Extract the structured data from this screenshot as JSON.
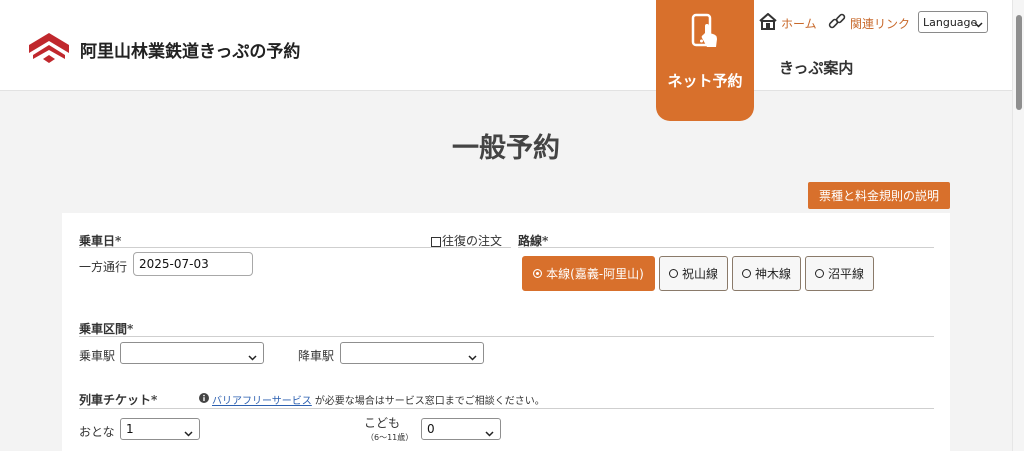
{
  "header": {
    "site_title": "阿里山林業鉄道きっぷの予約",
    "nav": {
      "net_reservation": "ネット予約",
      "ticket_guide": "きっぷ案内"
    },
    "links": {
      "home": "ホーム",
      "related": "関連リンク"
    },
    "language_select": "Language"
  },
  "page": {
    "title": "一般予約",
    "rules_button": "票種と料金規則の説明"
  },
  "form": {
    "ride_date": {
      "heading": "乗車日*",
      "one_way_label": "一方通行",
      "date_value": "2025-07-03",
      "round_trip_label": "往復の注文"
    },
    "route": {
      "heading": "路線*",
      "options": [
        "本線(嘉義-阿里山)",
        "祝山線",
        "神木線",
        "沼平線"
      ],
      "selected": "本線(嘉義-阿里山)"
    },
    "section": {
      "heading": "乗車区間*",
      "boarding_label": "乗車駅",
      "boarding_value": "",
      "alighting_label": "降車駅",
      "alighting_value": ""
    },
    "tickets": {
      "heading": "列車チケット*",
      "info_link": "バリアフリーサービス",
      "info_text": "が必要な場合はサービス窓口までご相談ください。",
      "adult_label": "おとな",
      "adult_value": "1",
      "child_label": "こども",
      "child_age": "（6〜11歳）",
      "child_value": "0"
    }
  },
  "colors": {
    "accent": "#d8702c",
    "logo_red": "#c0282d",
    "link_blue": "#2b5fb0",
    "background": "#f3f3f3"
  },
  "icons": {
    "logo": "arisan-logo-icon",
    "net_reservation": "touch-phone-icon",
    "home": "home-icon",
    "related": "link-icon",
    "info": "info-icon",
    "dropdown": "chevron-down-icon"
  }
}
